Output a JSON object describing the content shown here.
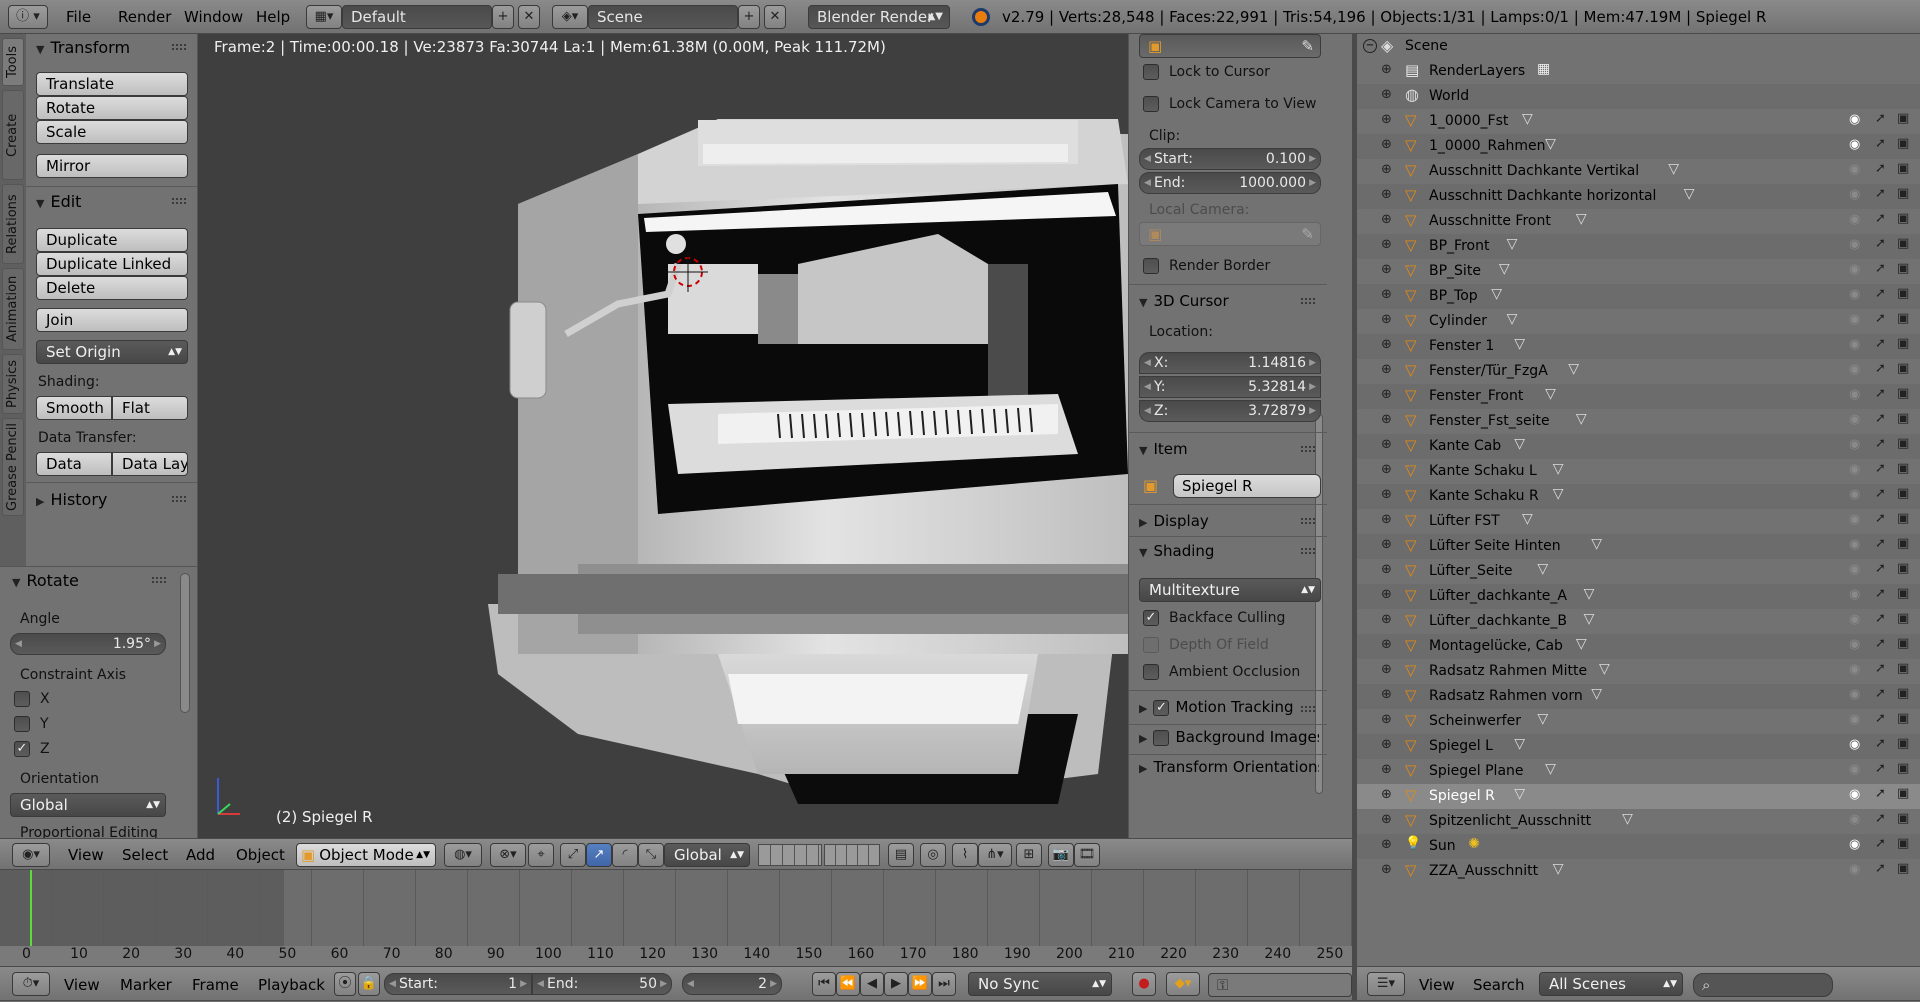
{
  "topbar": {
    "menus": [
      "File",
      "Render",
      "Window",
      "Help"
    ],
    "screen_layout": "Default",
    "scene": "Scene",
    "engine": "Blender Render",
    "stats": "v2.79 | Verts:28,548 | Faces:22,991 | Tris:54,196 | Objects:1/31 | Lamps:0/1 | Mem:47.19M | Spiegel R"
  },
  "viewport": {
    "info": "Frame:2 | Time:00:00.18 | Ve:23873 Fa:30744 La:1 | Mem:61.38M (0.00M, Peak 111.72M)",
    "object_label": "(2) Spiegel R",
    "menus": [
      "View",
      "Select",
      "Add",
      "Object"
    ],
    "mode": "Object Mode",
    "orientation": "Global"
  },
  "tool_tabs": [
    "Tools",
    "Create",
    "Relations",
    "Animation",
    "Physics",
    "Grease Pencil"
  ],
  "tools": {
    "transform_title": "Transform",
    "transform_buttons": [
      "Translate",
      "Rotate",
      "Scale",
      "Mirror"
    ],
    "edit_title": "Edit",
    "edit_buttons": [
      "Duplicate",
      "Duplicate Linked",
      "Delete",
      "Join"
    ],
    "set_origin": "Set Origin",
    "shading_label": "Shading:",
    "smooth": "Smooth",
    "flat": "Flat",
    "data_transfer_label": "Data Transfer:",
    "data": "Data",
    "data_lay": "Data Lay",
    "history": "History"
  },
  "operator": {
    "title": "Rotate",
    "angle_label": "Angle",
    "angle_value": "1.95°",
    "constraint_label": "Constraint Axis",
    "axes": [
      {
        "name": "X",
        "checked": false
      },
      {
        "name": "Y",
        "checked": false
      },
      {
        "name": "Z",
        "checked": true
      }
    ],
    "orientation_label": "Orientation",
    "orientation_value": "Global",
    "cut_label": "Proportional Editing"
  },
  "properties": {
    "lock_cursor": "Lock to Cursor",
    "lock_camera": "Lock Camera to View",
    "clip_label": "Clip:",
    "start_label": "Start:",
    "start_value": "0.100",
    "end_label": "End:",
    "end_value": "1000.000",
    "local_camera": "Local Camera:",
    "render_border": "Render Border",
    "cursor_title": "3D Cursor",
    "location_label": "Location:",
    "x_label": "X:",
    "x_value": "1.14816",
    "y_label": "Y:",
    "y_value": "5.32814",
    "z_label": "Z:",
    "z_value": "3.72879",
    "item_title": "Item",
    "item_name": "Spiegel R",
    "display_title": "Display",
    "shading_title": "Shading",
    "shading_mode": "Multitexture",
    "backface": "Backface Culling",
    "dof": "Depth Of Field",
    "ao": "Ambient Occlusion",
    "motion_tracking": "Motion Tracking",
    "background_images": "Background Images",
    "transform_orientations": "Transform Orientations"
  },
  "outliner": {
    "scene": "Scene",
    "rows": [
      {
        "name": "RenderLayers",
        "type": "renderlayers",
        "eye": false
      },
      {
        "name": "World",
        "type": "world",
        "eye": false
      },
      {
        "name": "1_0000_Fst",
        "type": "mesh",
        "eye": true
      },
      {
        "name": "1_0000_Rahmen",
        "type": "mesh",
        "eye": true
      },
      {
        "name": "Ausschnitt Dachkante Vertikal",
        "type": "mesh",
        "eye": false
      },
      {
        "name": "Ausschnitt Dachkante horizontal",
        "type": "mesh",
        "eye": false
      },
      {
        "name": "Ausschnitte Front",
        "type": "mesh",
        "eye": false
      },
      {
        "name": "BP_Front",
        "type": "mesh",
        "eye": false
      },
      {
        "name": "BP_Site",
        "type": "mesh",
        "eye": false
      },
      {
        "name": "BP_Top",
        "type": "mesh",
        "eye": false
      },
      {
        "name": "Cylinder",
        "type": "mesh",
        "eye": false
      },
      {
        "name": "Fenster 1",
        "type": "mesh",
        "eye": false
      },
      {
        "name": "Fenster/Tür_FzgA",
        "type": "mesh",
        "eye": false
      },
      {
        "name": "Fenster_Front",
        "type": "mesh",
        "eye": false
      },
      {
        "name": "Fenster_Fst_seite",
        "type": "mesh",
        "eye": false
      },
      {
        "name": "Kante Cab",
        "type": "mesh",
        "eye": false
      },
      {
        "name": "Kante Schaku L",
        "type": "mesh",
        "eye": false
      },
      {
        "name": "Kante Schaku R",
        "type": "mesh",
        "eye": false
      },
      {
        "name": "Lüfter FST",
        "type": "mesh",
        "eye": false
      },
      {
        "name": "Lüfter Seite Hinten",
        "type": "mesh",
        "eye": false
      },
      {
        "name": "Lüfter_Seite",
        "type": "mesh",
        "eye": false
      },
      {
        "name": "Lüfter_dachkante_A",
        "type": "mesh",
        "eye": false
      },
      {
        "name": "Lüfter_dachkante_B",
        "type": "mesh",
        "eye": false
      },
      {
        "name": "Montagelücke, Cab",
        "type": "mesh",
        "eye": false
      },
      {
        "name": "Radsatz Rahmen Mitte",
        "type": "mesh",
        "eye": false
      },
      {
        "name": "Radsatz Rahmen vorn",
        "type": "mesh",
        "eye": false
      },
      {
        "name": "Scheinwerfer",
        "type": "mesh",
        "eye": false
      },
      {
        "name": "Spiegel L",
        "type": "mesh",
        "eye": true
      },
      {
        "name": "Spiegel Plane",
        "type": "mesh",
        "eye": false
      },
      {
        "name": "Spiegel R",
        "type": "mesh",
        "eye": true,
        "selected": true
      },
      {
        "name": "Spitzenlicht_Ausschnitt",
        "type": "mesh",
        "eye": false
      },
      {
        "name": "Sun",
        "type": "lamp",
        "eye": true
      },
      {
        "name": "ZZA_Ausschnitt",
        "type": "mesh",
        "eye": false
      }
    ],
    "footer": {
      "view": "View",
      "search": "Search",
      "filter": "All Scenes"
    }
  },
  "timeline": {
    "ticks": [
      "0",
      "10",
      "20",
      "30",
      "40",
      "50",
      "60",
      "70",
      "80",
      "90",
      "100",
      "110",
      "120",
      "130",
      "140",
      "150",
      "160",
      "170",
      "180",
      "190",
      "200",
      "210",
      "220",
      "230",
      "240",
      "250"
    ],
    "current_frame": "2",
    "menus": [
      "View",
      "Marker",
      "Frame",
      "Playback"
    ],
    "start_label": "Start:",
    "start_value": "1",
    "end_label": "End:",
    "end_value": "50",
    "frame_value": "2",
    "sync": "No Sync"
  }
}
